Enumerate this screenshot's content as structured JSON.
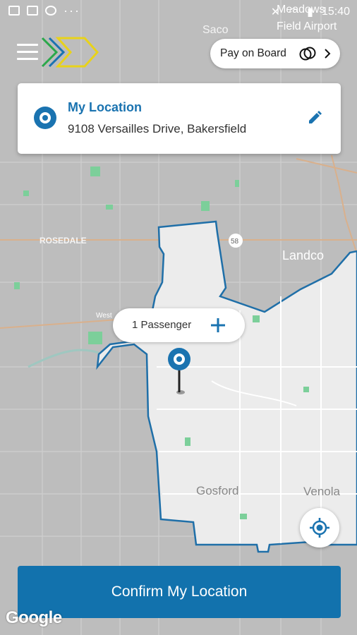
{
  "status_bar": {
    "time": "15:40"
  },
  "map": {
    "labels": {
      "saco": "Saco",
      "airport": "Meadows\nField Airport",
      "rosedale": "ROSEDALE",
      "route": "58",
      "landco": "Landco",
      "west": "West",
      "gosford": "Gosford",
      "venola": "Venola"
    },
    "google_logo": "Google"
  },
  "header": {
    "menu_icon": "hamburger-menu-icon",
    "logo": "chevron-arrows-logo",
    "pay_button": {
      "label": "Pay on Board",
      "icon": "overlapping-circles-icon",
      "chevron": "chevron-right-icon"
    }
  },
  "location_card": {
    "title": "My Location",
    "address": "9108 Versailles Drive, Bakersfield",
    "icon": "location-target-icon",
    "edit_icon": "pencil-icon"
  },
  "passenger": {
    "label": "1 Passenger",
    "add_icon": "plus-icon"
  },
  "recenter_icon": "my-location-crosshair-icon",
  "confirm_button": {
    "label": "Confirm My Location"
  },
  "colors": {
    "primary": "#1272ad",
    "title": "#1a73b0",
    "zone_border": "#1f6fa8"
  }
}
